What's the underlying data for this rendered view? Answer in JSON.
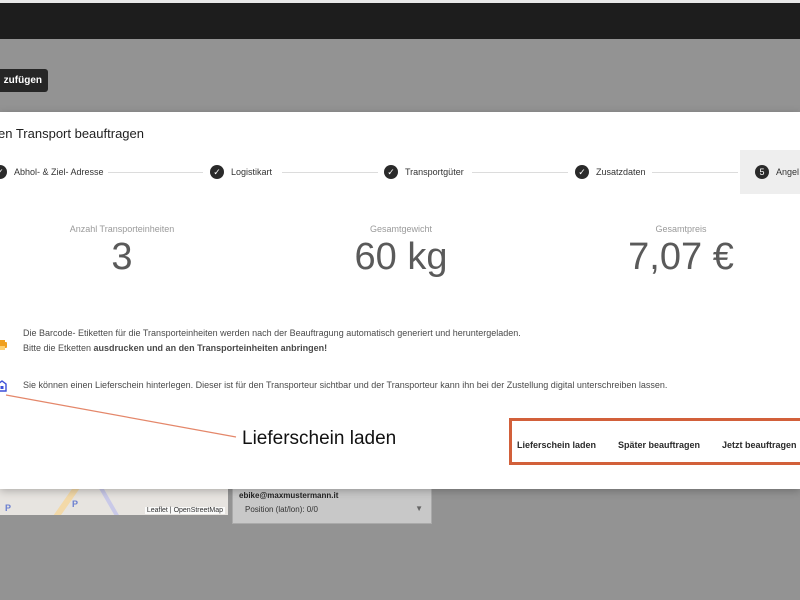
{
  "background": {
    "add_button_label": "zufügen",
    "map_parking_1": "P",
    "map_parking_2": "P",
    "map_attribution": "Leaflet | OpenStreetMap",
    "email": "ebike@maxmustermann.it",
    "position": "Position (lat/lon): 0/0"
  },
  "modal": {
    "title": "en Transport beauftragen",
    "steps": [
      {
        "label": "Abhol- & Ziel- Adresse",
        "icon": "check-icon"
      },
      {
        "label": "Logistikart",
        "icon": "check-icon"
      },
      {
        "label": "Transportgüter",
        "icon": "check-icon"
      },
      {
        "label": "Zusatzdaten",
        "icon": "check-icon"
      },
      {
        "label": "Angel",
        "number": "5"
      }
    ],
    "stats": [
      {
        "label": "Anzahl Transporteinheiten",
        "value": "3"
      },
      {
        "label": "Gesamtgewicht",
        "value": "60 kg"
      },
      {
        "label": "Gesamtpreis",
        "value": "7,07 €"
      }
    ],
    "barcode_info": {
      "line1": "Die Barcode- Etiketten für die Transporteinheiten werden nach der Beauftragung automatisch generiert und heruntergeladen.",
      "line2_prefix": "Bitte die Etketten ",
      "line2_bold": "ausdrucken und an den Transporteinheiten anbringen!"
    },
    "delivery_note_info": "Sie können einen Lieferschein hinterlegen. Dieser ist für den Transporteur sichtbar und der Transporteur kann ihn bei der Zustellung digital unterschreiben lassen.",
    "actions": {
      "upload_delivery_note": "Lieferschein laden",
      "order_later": "Später beauftragen",
      "order_now": "Jetzt beauftragen"
    }
  },
  "annotation": {
    "callout_label": "Lieferschein laden",
    "highlight_color": "#d2603a"
  }
}
